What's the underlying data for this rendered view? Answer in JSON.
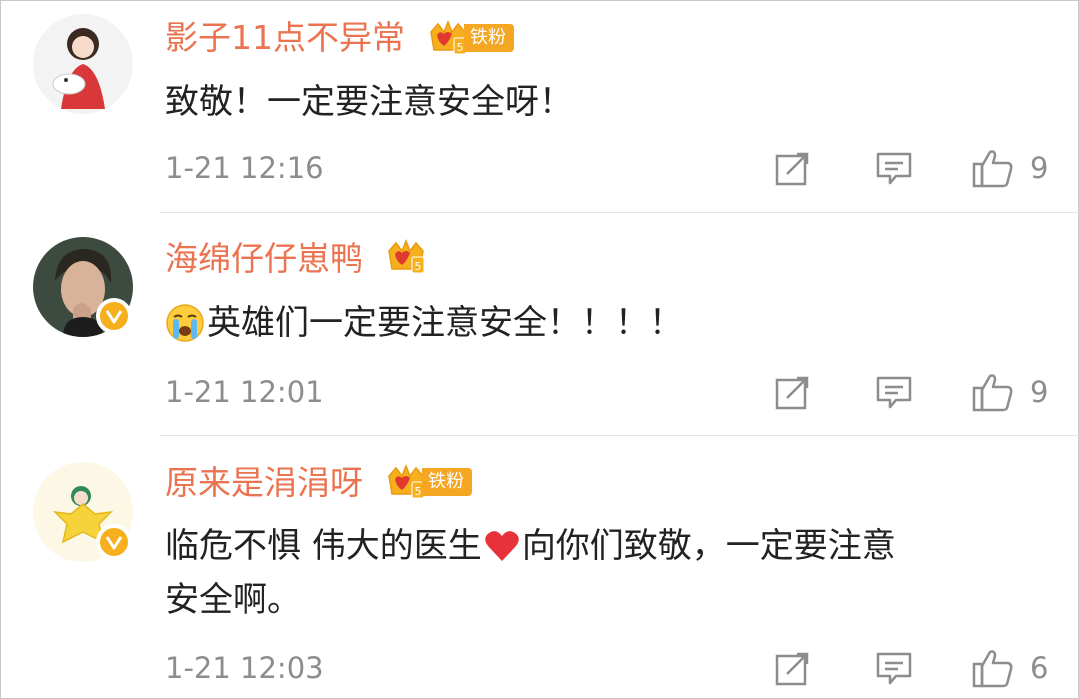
{
  "comments": [
    {
      "username": "影子11点不异常",
      "fan_badge": "铁粉",
      "text": "致敬！一定要注意安全呀！",
      "time": "1-21 12:16",
      "likes": "9"
    },
    {
      "username": "海绵仔仔崽鸭",
      "fan_badge": "",
      "text": "英雄们一定要注意安全！！！！",
      "time": "1-21 12:01",
      "likes": "9"
    },
    {
      "username": "原来是涓涓呀",
      "fan_badge": "铁粉",
      "text_line1": "临危不惧 伟大的医生",
      "text_line1b": "向你们致敬，一定要注意",
      "text_line2": "安全啊。",
      "time": "1-21 12:03",
      "likes": "6"
    }
  ],
  "colors": {
    "username": "#eb7350",
    "badge": "#f5a623",
    "meta": "#8d8d8d",
    "verified": "#f6b01e"
  },
  "icons": [
    "share-icon",
    "comment-icon",
    "like-icon",
    "crown-level-icon",
    "verified-v-icon",
    "crying-emoji-icon",
    "heart-emoji-icon"
  ]
}
